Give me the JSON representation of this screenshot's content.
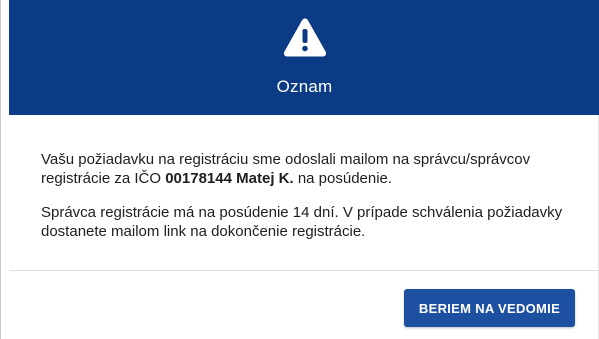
{
  "dialog": {
    "icon": "warning-triangle-icon",
    "title": "Oznam",
    "header_color": "#0b3b84",
    "paragraph1": {
      "text_before": "Vašu požiadavku na registráciu sme odoslali mailom na správcu/správcov registrácie za IČO ",
      "ico": "00178144",
      "name": "Matej K.",
      "text_after": " na posúdenie."
    },
    "paragraph2": "Správca registrácie má na posúdenie 14 dní. V prípade schválenia požiadavky dostanete mailom link na dokončenie registrácie.",
    "confirm_button": {
      "label": "BERIEM NA VEDOMIE",
      "color": "#1e50a2"
    }
  }
}
